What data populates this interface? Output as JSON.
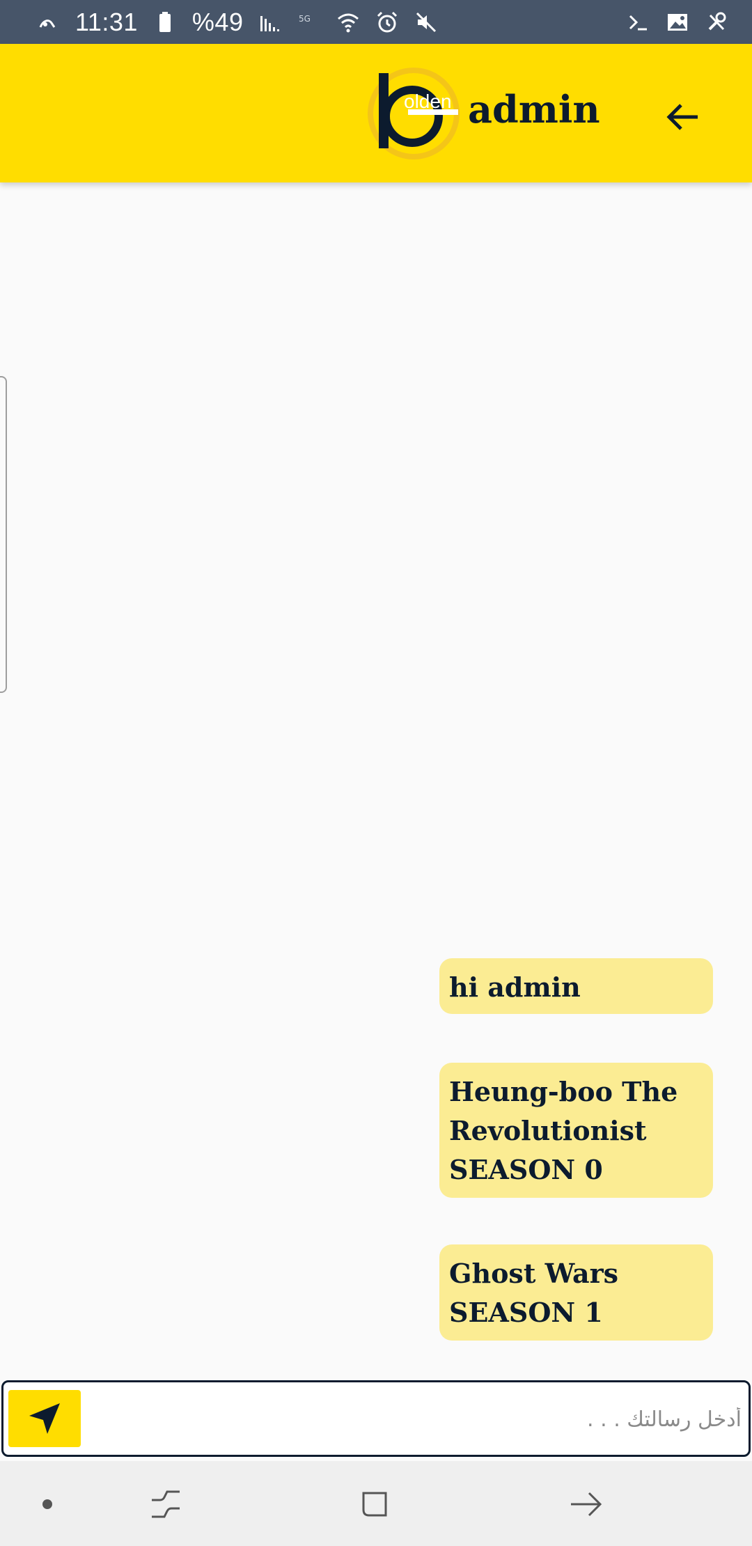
{
  "status_bar": {
    "time": "11:31",
    "battery": "%49"
  },
  "header": {
    "title": "admin",
    "logo_text": "olden"
  },
  "messages": [
    {
      "text": "hi admin"
    },
    {
      "text": "Heung-boo The Revolutionist SEASON 0"
    },
    {
      "text": "Ghost Wars SEASON 1"
    }
  ],
  "composer": {
    "placeholder": "أدخل رسالتك . . .",
    "value": ""
  },
  "colors": {
    "accent": "#ffdd00",
    "bubble": "#fbec93",
    "text_dark": "#0c1b2e",
    "status_bar": "#475569"
  },
  "icons": {
    "back": "arrow-left-icon",
    "send": "send-arrow-icon"
  }
}
